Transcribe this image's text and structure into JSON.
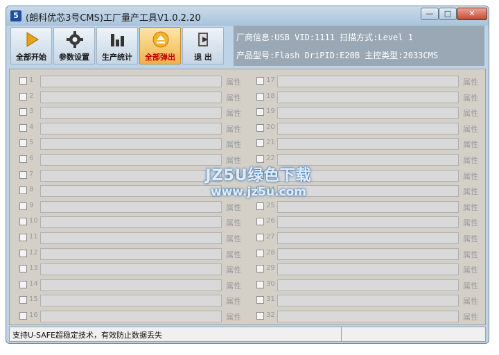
{
  "window": {
    "title": "(朗科优芯3号CMS)工厂量产工具V1.0.2.20",
    "app_icon_glyph": "5"
  },
  "window_controls": {
    "minimize": "—",
    "maximize": "□",
    "close": "✕"
  },
  "toolbar": {
    "buttons": [
      {
        "label": "全部开始",
        "icon": "play-icon",
        "active": false
      },
      {
        "label": "参数设置",
        "icon": "gear-icon",
        "active": false
      },
      {
        "label": "生产统计",
        "icon": "bar-chart-icon",
        "active": false
      },
      {
        "label": "全部弹出",
        "icon": "eject-icon",
        "active": true
      },
      {
        "label": "退  出",
        "icon": "exit-icon",
        "active": false
      }
    ]
  },
  "info": {
    "line1": "厂商信息:USB      VID:1111 扫描方式:Level 1",
    "line2": "产品型号:Flash DriPID:E20B 主控类型:2033CMS"
  },
  "ports": {
    "attr_label": "属性",
    "left": [
      "1",
      "2",
      "3",
      "4",
      "5",
      "6",
      "7",
      "8",
      "9",
      "10",
      "11",
      "12",
      "13",
      "14",
      "15",
      "16"
    ],
    "right": [
      "17",
      "18",
      "19",
      "20",
      "21",
      "22",
      "23",
      "24",
      "25",
      "26",
      "27",
      "28",
      "29",
      "30",
      "31",
      "32"
    ]
  },
  "watermark": {
    "line1": "JZ5U绿色下载",
    "line2": "www.jz5u.com"
  },
  "status": {
    "text": "支持U-SAFE超稳定技术，有效防止数据丢失",
    "right": ""
  },
  "colors": {
    "title_bg": "#bcd3e8",
    "info_bg": "#9aa8b6",
    "active_label": "#c00000",
    "panel_bg": "#d4d0c8"
  }
}
